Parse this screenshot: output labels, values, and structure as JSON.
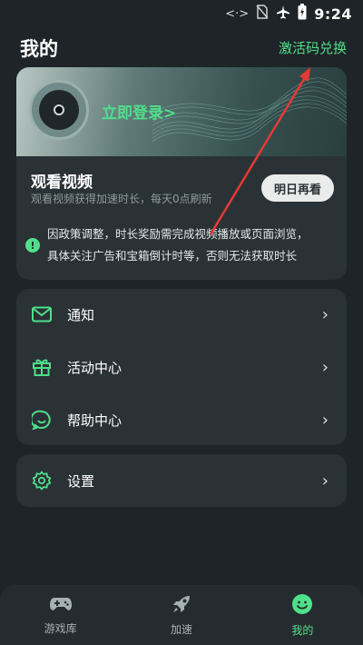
{
  "status_bar": {
    "time": "9:24",
    "icons": [
      "code-icon",
      "no-sim-icon",
      "airplane-icon",
      "battery-charging-icon"
    ]
  },
  "header": {
    "title": "我的",
    "redeem_label": "激活码兑换"
  },
  "login_card": {
    "login_label": "立即登录>",
    "watch_title": "观看视频",
    "watch_subtitle": "观看视频获得加速时长，每天0点刷新",
    "watch_button": "明日再看",
    "notice_line1": "因政策调整，时长奖励需完成视频播放或页面浏览，",
    "notice_line2": "具体关注广告和宝箱倒计时等，否则无法获取时长"
  },
  "menu": {
    "items": [
      {
        "label": "通知",
        "icon": "mail-icon"
      },
      {
        "label": "活动中心",
        "icon": "gift-icon"
      },
      {
        "label": "帮助中心",
        "icon": "chat-icon"
      }
    ],
    "settings_label": "设置"
  },
  "tabbar": {
    "tabs": [
      {
        "label": "游戏库",
        "icon": "gamepad-icon"
      },
      {
        "label": "加速",
        "icon": "rocket-icon"
      },
      {
        "label": "我的",
        "icon": "smiley-icon",
        "active": true
      }
    ]
  },
  "colors": {
    "accent": "#4fe08a",
    "background": "#1e2427",
    "card": "#2a3236",
    "annotation": "#e53935"
  }
}
